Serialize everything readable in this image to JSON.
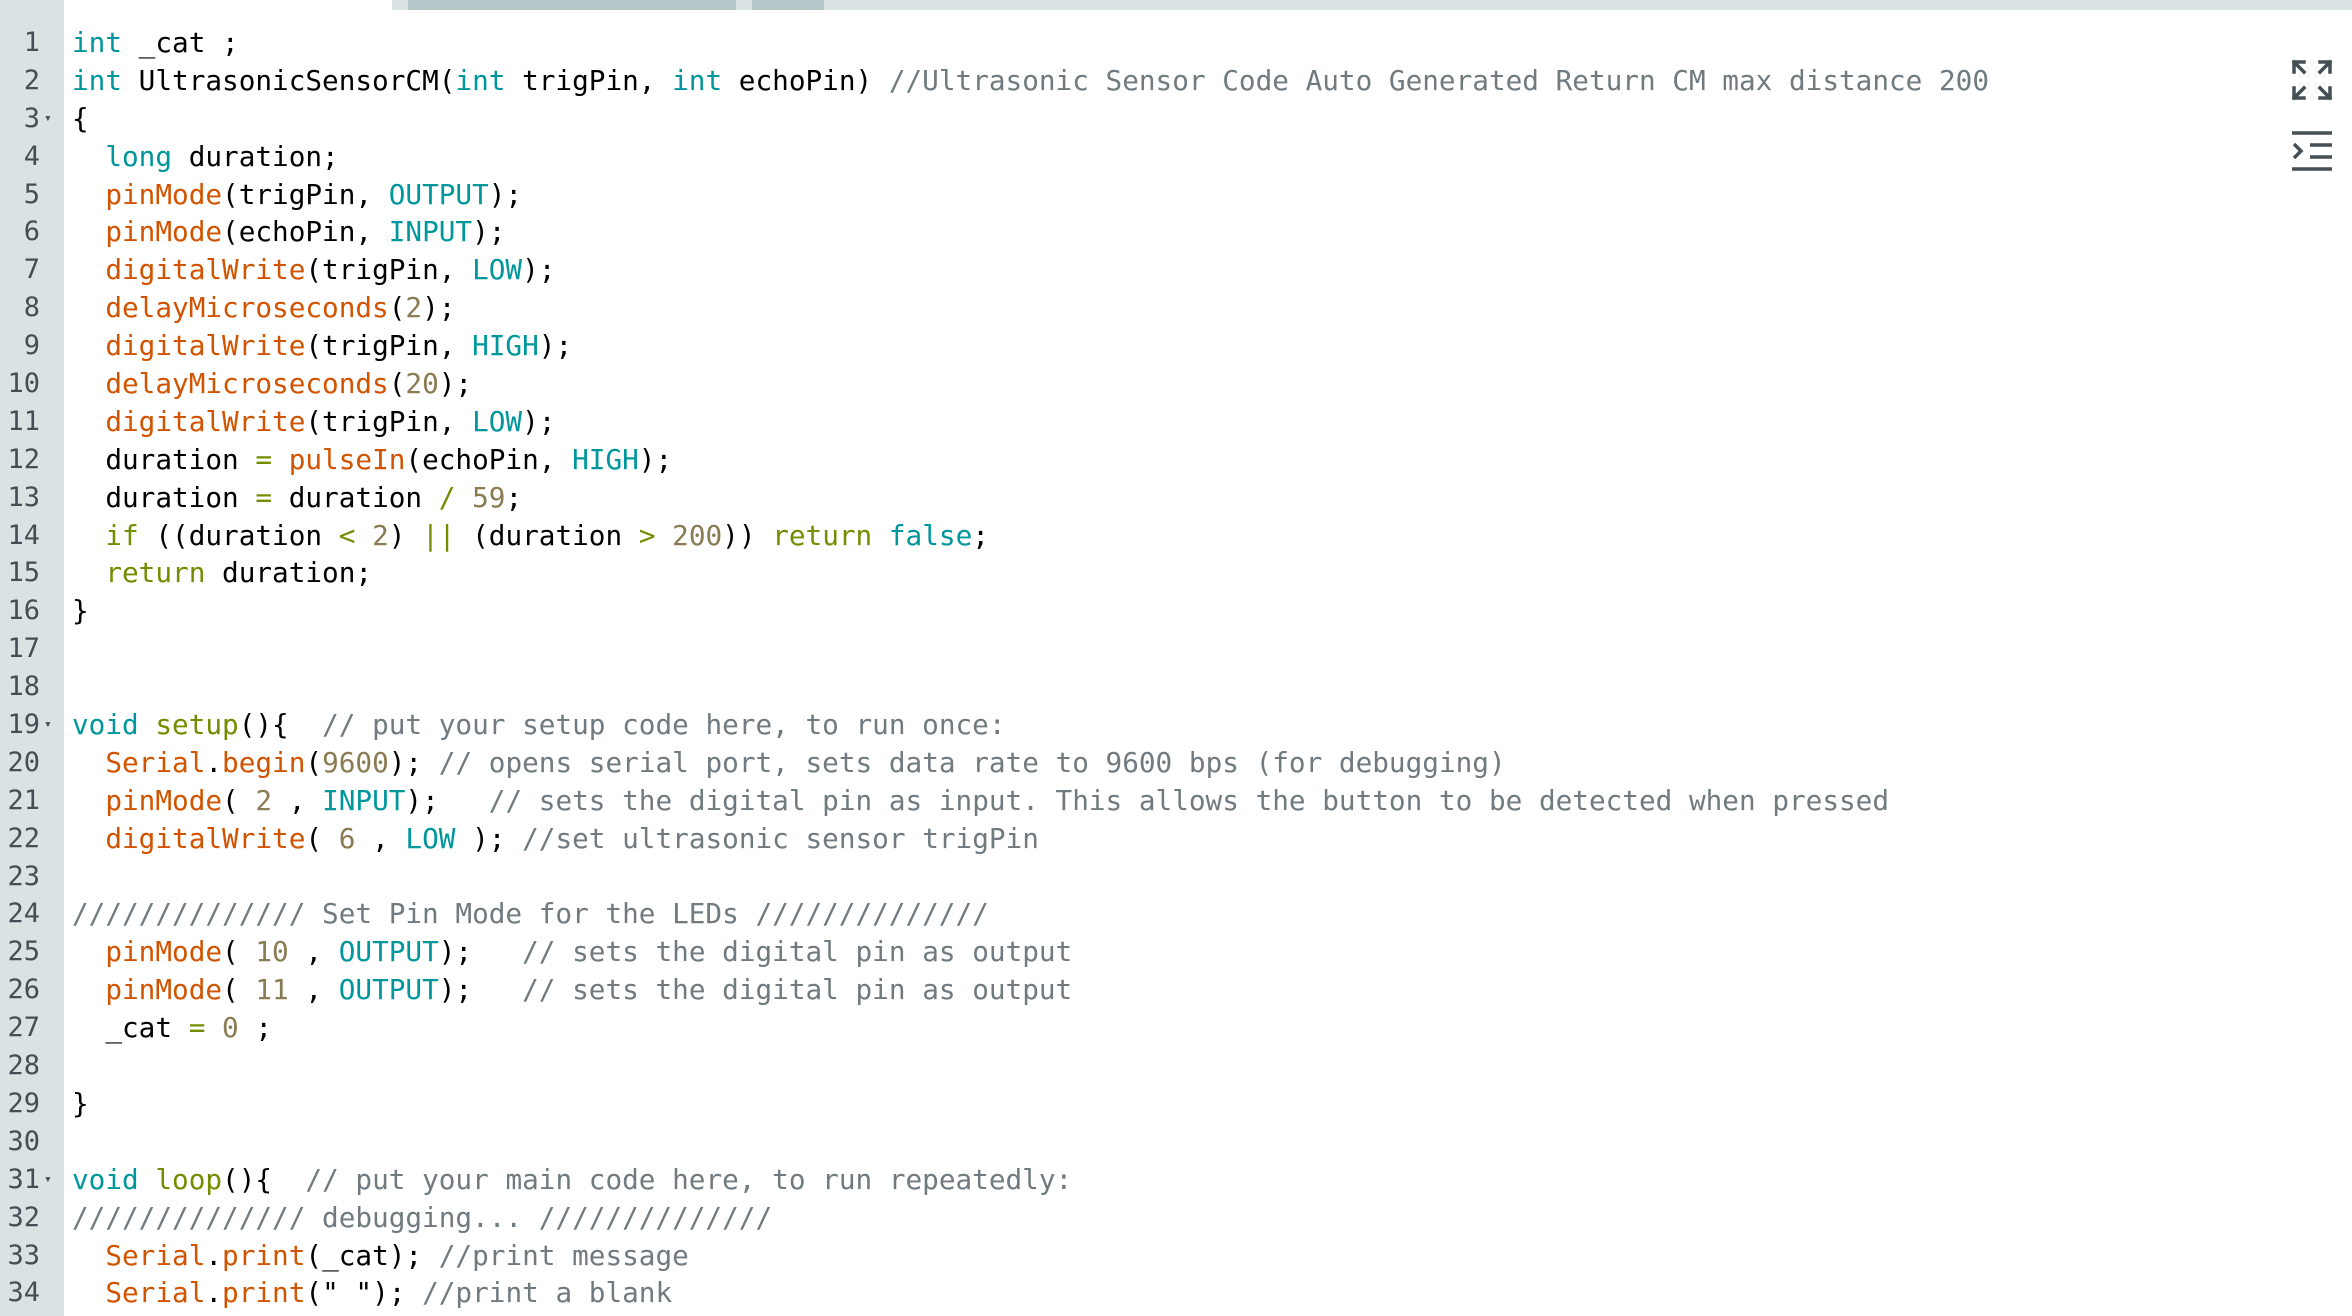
{
  "editor": {
    "lines": [
      {
        "n": "1",
        "fold": false,
        "tokens": [
          [
            "kw",
            "int"
          ],
          [
            "txt",
            " _cat ;"
          ]
        ]
      },
      {
        "n": "2",
        "fold": false,
        "tokens": [
          [
            "kw",
            "int"
          ],
          [
            "txt",
            " UltrasonicSensorCM("
          ],
          [
            "kw",
            "int"
          ],
          [
            "txt",
            " trigPin, "
          ],
          [
            "kw",
            "int"
          ],
          [
            "txt",
            " echoPin) "
          ],
          [
            "cm",
            "//Ultrasonic Sensor Code Auto Generated Return CM max distance 200"
          ]
        ]
      },
      {
        "n": "3",
        "fold": true,
        "tokens": [
          [
            "txt",
            "{"
          ]
        ]
      },
      {
        "n": "4",
        "fold": false,
        "tokens": [
          [
            "txt",
            "  "
          ],
          [
            "kw",
            "long"
          ],
          [
            "txt",
            " duration;"
          ]
        ]
      },
      {
        "n": "5",
        "fold": false,
        "tokens": [
          [
            "txt",
            "  "
          ],
          [
            "fn",
            "pinMode"
          ],
          [
            "txt",
            "(trigPin, "
          ],
          [
            "kw",
            "OUTPUT"
          ],
          [
            "txt",
            ");"
          ]
        ]
      },
      {
        "n": "6",
        "fold": false,
        "tokens": [
          [
            "txt",
            "  "
          ],
          [
            "fn",
            "pinMode"
          ],
          [
            "txt",
            "(echoPin, "
          ],
          [
            "kw",
            "INPUT"
          ],
          [
            "txt",
            ");"
          ]
        ]
      },
      {
        "n": "7",
        "fold": false,
        "tokens": [
          [
            "txt",
            "  "
          ],
          [
            "fn",
            "digitalWrite"
          ],
          [
            "txt",
            "(trigPin, "
          ],
          [
            "kw",
            "LOW"
          ],
          [
            "txt",
            ");"
          ]
        ]
      },
      {
        "n": "8",
        "fold": false,
        "tokens": [
          [
            "txt",
            "  "
          ],
          [
            "fn",
            "delayMicroseconds"
          ],
          [
            "txt",
            "("
          ],
          [
            "num",
            "2"
          ],
          [
            "txt",
            ");"
          ]
        ]
      },
      {
        "n": "9",
        "fold": false,
        "tokens": [
          [
            "txt",
            "  "
          ],
          [
            "fn",
            "digitalWrite"
          ],
          [
            "txt",
            "(trigPin, "
          ],
          [
            "kw",
            "HIGH"
          ],
          [
            "txt",
            ");"
          ]
        ]
      },
      {
        "n": "10",
        "fold": false,
        "tokens": [
          [
            "txt",
            "  "
          ],
          [
            "fn",
            "delayMicroseconds"
          ],
          [
            "txt",
            "("
          ],
          [
            "num",
            "20"
          ],
          [
            "txt",
            ");"
          ]
        ]
      },
      {
        "n": "11",
        "fold": false,
        "tokens": [
          [
            "txt",
            "  "
          ],
          [
            "fn",
            "digitalWrite"
          ],
          [
            "txt",
            "(trigPin, "
          ],
          [
            "kw",
            "LOW"
          ],
          [
            "txt",
            ");"
          ]
        ]
      },
      {
        "n": "12",
        "fold": false,
        "tokens": [
          [
            "txt",
            "  duration "
          ],
          [
            "ctl",
            "="
          ],
          [
            "txt",
            " "
          ],
          [
            "fn",
            "pulseIn"
          ],
          [
            "txt",
            "(echoPin, "
          ],
          [
            "kw",
            "HIGH"
          ],
          [
            "txt",
            ");"
          ]
        ]
      },
      {
        "n": "13",
        "fold": false,
        "tokens": [
          [
            "txt",
            "  duration "
          ],
          [
            "ctl",
            "="
          ],
          [
            "txt",
            " duration "
          ],
          [
            "ctl",
            "/"
          ],
          [
            "txt",
            " "
          ],
          [
            "num",
            "59"
          ],
          [
            "txt",
            ";"
          ]
        ]
      },
      {
        "n": "14",
        "fold": false,
        "tokens": [
          [
            "txt",
            "  "
          ],
          [
            "ctl",
            "if"
          ],
          [
            "txt",
            " ((duration "
          ],
          [
            "ctl",
            "<"
          ],
          [
            "txt",
            " "
          ],
          [
            "num",
            "2"
          ],
          [
            "txt",
            ") "
          ],
          [
            "ctl",
            "||"
          ],
          [
            "txt",
            " (duration "
          ],
          [
            "ctl",
            ">"
          ],
          [
            "txt",
            " "
          ],
          [
            "num",
            "200"
          ],
          [
            "txt",
            ")) "
          ],
          [
            "ctl",
            "return"
          ],
          [
            "txt",
            " "
          ],
          [
            "kw",
            "false"
          ],
          [
            "txt",
            ";"
          ]
        ]
      },
      {
        "n": "15",
        "fold": false,
        "tokens": [
          [
            "txt",
            "  "
          ],
          [
            "ctl",
            "return"
          ],
          [
            "txt",
            " duration;"
          ]
        ]
      },
      {
        "n": "16",
        "fold": false,
        "tokens": [
          [
            "txt",
            "}"
          ]
        ]
      },
      {
        "n": "17",
        "fold": false,
        "tokens": []
      },
      {
        "n": "18",
        "fold": false,
        "tokens": []
      },
      {
        "n": "19",
        "fold": true,
        "tokens": [
          [
            "kw",
            "void"
          ],
          [
            "txt",
            " "
          ],
          [
            "ctl",
            "setup"
          ],
          [
            "txt",
            "(){  "
          ],
          [
            "cm",
            "// put your setup code here, to run once:"
          ]
        ]
      },
      {
        "n": "20",
        "fold": false,
        "tokens": [
          [
            "txt",
            "  "
          ],
          [
            "fn",
            "Serial"
          ],
          [
            "txt",
            "."
          ],
          [
            "fn",
            "begin"
          ],
          [
            "txt",
            "("
          ],
          [
            "num",
            "9600"
          ],
          [
            "txt",
            "); "
          ],
          [
            "cm",
            "// opens serial port, sets data rate to 9600 bps (for debugging)"
          ]
        ]
      },
      {
        "n": "21",
        "fold": false,
        "tokens": [
          [
            "txt",
            "  "
          ],
          [
            "fn",
            "pinMode"
          ],
          [
            "txt",
            "( "
          ],
          [
            "num",
            "2"
          ],
          [
            "txt",
            " , "
          ],
          [
            "kw",
            "INPUT"
          ],
          [
            "txt",
            ");   "
          ],
          [
            "cm",
            "// sets the digital pin as input. This allows the button to be detected when pressed"
          ]
        ]
      },
      {
        "n": "22",
        "fold": false,
        "tokens": [
          [
            "txt",
            "  "
          ],
          [
            "fn",
            "digitalWrite"
          ],
          [
            "txt",
            "( "
          ],
          [
            "num",
            "6"
          ],
          [
            "txt",
            " , "
          ],
          [
            "kw",
            "LOW"
          ],
          [
            "txt",
            " ); "
          ],
          [
            "cm",
            "//set ultrasonic sensor trigPin"
          ]
        ]
      },
      {
        "n": "23",
        "fold": false,
        "tokens": []
      },
      {
        "n": "24",
        "fold": false,
        "tokens": [
          [
            "cm",
            "////////////// Set Pin Mode for the LEDs //////////////"
          ]
        ]
      },
      {
        "n": "25",
        "fold": false,
        "tokens": [
          [
            "txt",
            "  "
          ],
          [
            "fn",
            "pinMode"
          ],
          [
            "txt",
            "( "
          ],
          [
            "num",
            "10"
          ],
          [
            "txt",
            " , "
          ],
          [
            "kw",
            "OUTPUT"
          ],
          [
            "txt",
            ");   "
          ],
          [
            "cm",
            "// sets the digital pin as output"
          ]
        ]
      },
      {
        "n": "26",
        "fold": false,
        "tokens": [
          [
            "txt",
            "  "
          ],
          [
            "fn",
            "pinMode"
          ],
          [
            "txt",
            "( "
          ],
          [
            "num",
            "11"
          ],
          [
            "txt",
            " , "
          ],
          [
            "kw",
            "OUTPUT"
          ],
          [
            "txt",
            ");   "
          ],
          [
            "cm",
            "// sets the digital pin as output"
          ]
        ]
      },
      {
        "n": "27",
        "fold": false,
        "tokens": [
          [
            "txt",
            "  _cat "
          ],
          [
            "ctl",
            "="
          ],
          [
            "txt",
            " "
          ],
          [
            "num",
            "0"
          ],
          [
            "txt",
            " ;"
          ]
        ]
      },
      {
        "n": "28",
        "fold": false,
        "tokens": []
      },
      {
        "n": "29",
        "fold": false,
        "tokens": [
          [
            "txt",
            "}"
          ]
        ]
      },
      {
        "n": "30",
        "fold": false,
        "tokens": []
      },
      {
        "n": "31",
        "fold": true,
        "tokens": [
          [
            "kw",
            "void"
          ],
          [
            "txt",
            " "
          ],
          [
            "ctl",
            "loop"
          ],
          [
            "txt",
            "(){  "
          ],
          [
            "cm",
            "// put your main code here, to run repeatedly:"
          ]
        ]
      },
      {
        "n": "32",
        "fold": false,
        "tokens": [
          [
            "cm",
            "////////////// debugging... //////////////"
          ]
        ]
      },
      {
        "n": "33",
        "fold": false,
        "tokens": [
          [
            "txt",
            "  "
          ],
          [
            "fn",
            "Serial"
          ],
          [
            "txt",
            "."
          ],
          [
            "fn",
            "print"
          ],
          [
            "txt",
            "(_cat); "
          ],
          [
            "cm",
            "//print message"
          ]
        ]
      },
      {
        "n": "34",
        "fold": false,
        "tokens": [
          [
            "txt",
            "  "
          ],
          [
            "fn",
            "Serial"
          ],
          [
            "txt",
            "."
          ],
          [
            "fn",
            "print"
          ],
          [
            "txt",
            "(\" \"); "
          ],
          [
            "cm",
            "//print a blank"
          ]
        ]
      }
    ],
    "fold_glyph": "▾"
  },
  "side_icons": {
    "expand": "expand-icon",
    "indent": "indent-icon"
  },
  "colors": {
    "keyword": "#00979c",
    "function": "#d35400",
    "control": "#728e00",
    "number": "#8a7b52",
    "comment": "#707a7f",
    "gutter": "#dae3e3"
  }
}
